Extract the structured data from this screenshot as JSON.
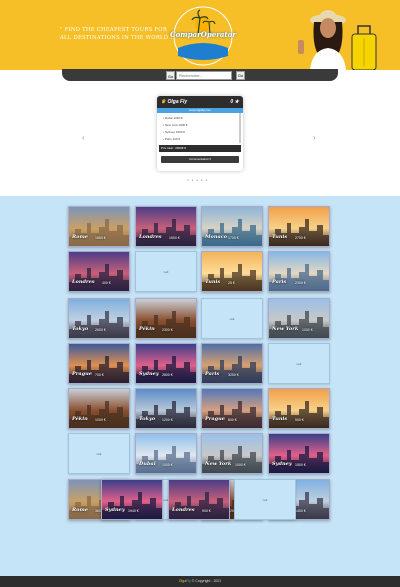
{
  "header": {
    "tagline": "\" Find the cheapest tours for all destinations in the world ! \"",
    "logo_text": "ComparOperator"
  },
  "search": {
    "left_btn": "Go",
    "placeholder": "Rechercher...",
    "go_btn": "Go"
  },
  "carousel": {
    "prev": "‹",
    "next": "›",
    "card": {
      "title": "Olga Fly",
      "rating": "0 ★",
      "subtitle": "www.olgafly.com",
      "items": [
        "Dubai 1000 €",
        "New York 1000 €",
        "Sydney 1500 €",
        "Paris 100 €"
      ],
      "total": "Prix total : 3600€ €",
      "button": "Commentaires ▾"
    },
    "dots": "● ● ● ● ●"
  },
  "tiles": [
    {
      "city": "Rome",
      "price": "1650 €",
      "scene": "rome"
    },
    {
      "city": "Londres",
      "price": "1500 €",
      "scene": "london"
    },
    {
      "city": "Monaco",
      "price": "1700 €",
      "scene": "monaco"
    },
    {
      "city": "Tunis",
      "price": "2700 €",
      "scene": "tunis"
    },
    {
      "city": "Londres",
      "price": "400 €",
      "scene": "london"
    },
    {
      "city": "",
      "price": "",
      "scene": "empty",
      "ph": "null"
    },
    {
      "city": "Tunis",
      "price": "25 €",
      "scene": "tunis2"
    },
    {
      "city": "Paris",
      "price": "2300 €",
      "scene": "paris"
    },
    {
      "city": "Tokyo",
      "price": "2600 €",
      "scene": "tokyo"
    },
    {
      "city": "Pékin",
      "price": "2300 €",
      "scene": "pekin"
    },
    {
      "city": "",
      "price": "",
      "scene": "empty",
      "ph": "null"
    },
    {
      "city": "New York",
      "price": "1000 €",
      "scene": "newyork"
    },
    {
      "city": "Prague",
      "price": "700 €",
      "scene": "prague"
    },
    {
      "city": "Sydney",
      "price": "2800 €",
      "scene": "sydney"
    },
    {
      "city": "Paris",
      "price": "3250 €",
      "scene": "paris2"
    },
    {
      "city": "",
      "price": "",
      "scene": "empty",
      "ph": "null"
    },
    {
      "city": "Pékin",
      "price": "1000 €",
      "scene": "pekin"
    },
    {
      "city": "Tokyo",
      "price": "1200 €",
      "scene": "tokyo2"
    },
    {
      "city": "Prague",
      "price": "800 €",
      "scene": "prague2"
    },
    {
      "city": "Tunis",
      "price": "500 €",
      "scene": "tunis"
    },
    {
      "city": "",
      "price": "",
      "scene": "empty",
      "ph": "null"
    },
    {
      "city": "Dubaï",
      "price": "1000 €",
      "scene": "dubai"
    },
    {
      "city": "New York",
      "price": "1000 €",
      "scene": "newyork"
    },
    {
      "city": "Sydney",
      "price": "1500 €",
      "scene": "sydney"
    },
    {
      "city": "Rome",
      "price": "360 €",
      "scene": "rome"
    },
    {
      "city": "",
      "price": "",
      "scene": "empty",
      "ph": "null"
    },
    {
      "city": "Pékin",
      "price": "1200 €",
      "scene": "pekin"
    },
    {
      "city": "Tokyo",
      "price": "1400 €",
      "scene": "tokyo"
    },
    {
      "city": "Sydney",
      "price": "1940 €",
      "scene": "sydney"
    },
    {
      "city": "Londres",
      "price": "900 €",
      "scene": "london"
    },
    {
      "city": "",
      "price": "",
      "scene": "empty",
      "ph": "null"
    }
  ],
  "footer": {
    "brand": "Olga",
    "brand2": "Fly",
    "text": " © Copyright - 2021"
  },
  "colors": {
    "accent": "#f6bf28",
    "dark": "#2d2d2d",
    "grid_bg": "#c6e4f7",
    "link": "#4aa3e0"
  }
}
